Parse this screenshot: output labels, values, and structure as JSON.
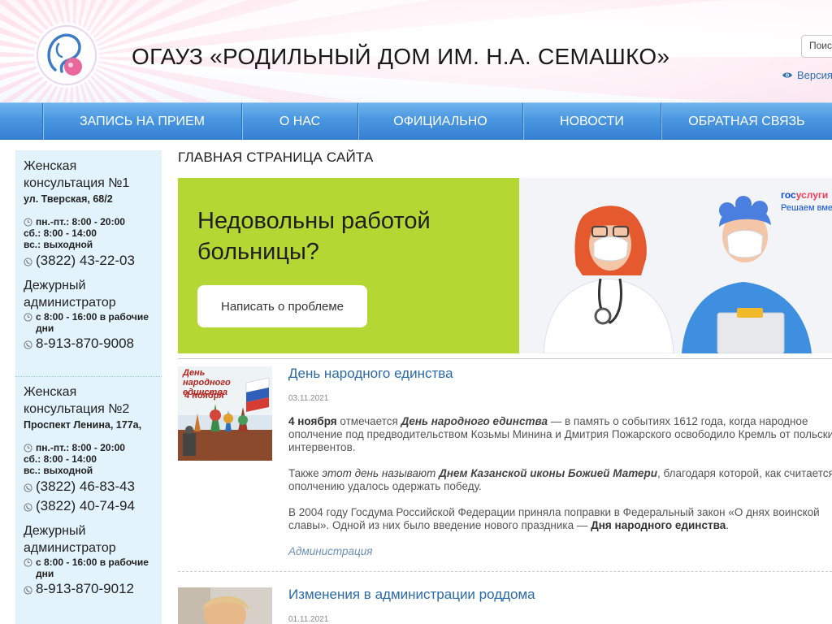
{
  "header": {
    "title": "ОГАУЗ «РОДИЛЬНЫЙ ДОМ ИМ. Н.А. СЕМАШКО»",
    "search_placeholder": "Поиск",
    "vision_link": "Версия для слабовидящих"
  },
  "nav": {
    "items": [
      {
        "label": "Запись на прием"
      },
      {
        "label": "О нас"
      },
      {
        "label": "Официально"
      },
      {
        "label": "Новости"
      },
      {
        "label": "Обратная связь"
      }
    ]
  },
  "sidebar": {
    "clinic1": {
      "title": "Женская консультация №1",
      "address": "ул. Тверская, 68/2",
      "hours": [
        "пн.-пт.: 8:00 - 20:00",
        "сб.: 8:00 - 14:00",
        "вс.: выходной"
      ],
      "phones": [
        "(3822) 43-22-03"
      ],
      "duty_title": "Дежурный администратор",
      "duty_hours": "с 8:00 - 16:00 в рабочие дни",
      "duty_phone": "8-913-870-9008"
    },
    "clinic2": {
      "title": "Женская консультация №2",
      "address": "Проспект Ленина, 177а,",
      "hours": [
        "пн.-пт.: 8:00 - 20:00",
        "сб.: 8:00 - 14:00",
        "вс.: выходной"
      ],
      "phones": [
        "(3822) 46-83-43",
        "(3822) 40-74-94"
      ],
      "duty_title": "Дежурный администратор",
      "duty_hours": "с 8:00 - 16:00 в рабочие дни",
      "duty_phone": "8-913-870-9012"
    }
  },
  "main": {
    "heading": "Главная страница сайта",
    "banner": {
      "headline": "Недовольны работой больницы?",
      "button": "Написать о проблеме",
      "gos_logo_part1": "гос",
      "gos_logo_part2": "услуги",
      "gos_sub": "Решаем вместе"
    },
    "news": [
      {
        "title": "День народного единства",
        "date": "03.11.2021",
        "thumb_caption": "День народного единства",
        "thumb_date": "4 ноября",
        "p1_bold1": "4 ноября",
        "p1_text1": " отмечается ",
        "p1_bold2": "День народного единства",
        "p1_text2": " — в память о событиях 1612 года, когда народное ополчение под предводительством Козьмы Минина и Дмитрия Пожарского освободило Кремль от польских интервентов.",
        "p2_text1": "Также ",
        "p2_italic": "этот день называют",
        "p2_bold": "Днем Казанской иконы Божией Матери",
        "p2_text2": ", благодаря которой, как считается, ополчению удалось одержать победу.",
        "p3_text1": "В 2004 году Госдума Российской Федерации приняла поправки в Федеральный закон «О днях воинской славы». Одной из них было введение нового праздника — ",
        "p3_bold": "Дня народного единства",
        "p3_text2": ".",
        "author": "Администрация"
      },
      {
        "title": "Изменения в администрации роддома",
        "date": "01.11.2021"
      }
    ]
  },
  "colors": {
    "nav_blue": "#4a97e0",
    "sidebar_bg": "#e2f3fc",
    "banner_green": "#b5d734",
    "link_blue": "#2a6aa8"
  }
}
